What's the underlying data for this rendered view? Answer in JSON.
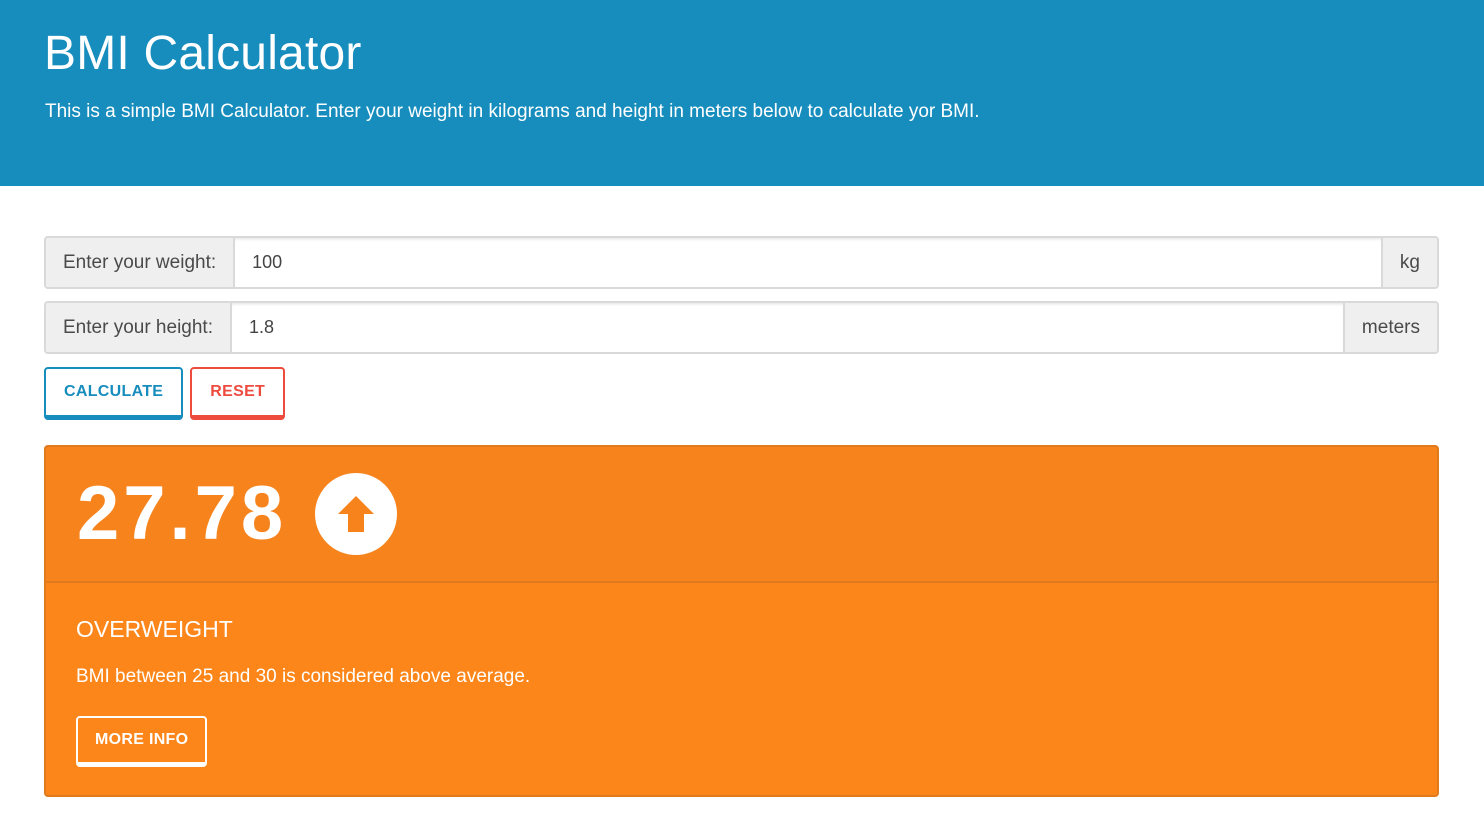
{
  "header": {
    "title": "BMI Calculator",
    "description": "This is a simple BMI Calculator. Enter your weight in kilograms and height in meters below to calculate yor BMI."
  },
  "form": {
    "weight": {
      "label": "Enter your weight:",
      "value": "100",
      "unit": "kg"
    },
    "height": {
      "label": "Enter your height:",
      "value": "1.8",
      "unit": "meters"
    }
  },
  "buttons": {
    "calculate": "CALCULATE",
    "reset": "RESET"
  },
  "result": {
    "bmi": "27.78",
    "trend_icon": "arrow-up-circle-icon",
    "category": "OVERWEIGHT",
    "description": "BMI between 25 and 30 is considered above average.",
    "more_info": "MORE INFO"
  },
  "colors": {
    "header_bg": "#178dbd",
    "result_bg": "#fc8619",
    "calculate_accent": "#178dbd",
    "reset_accent": "#ee4b3f"
  }
}
